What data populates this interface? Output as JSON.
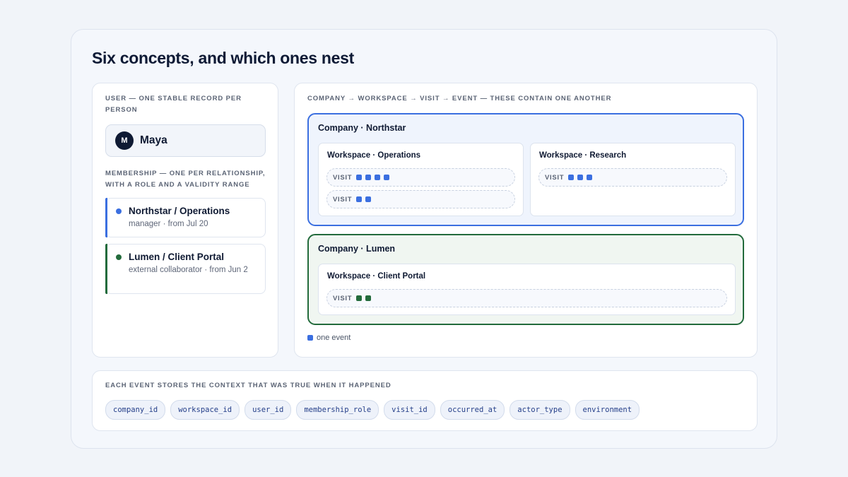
{
  "title": "Six concepts, and which ones nest",
  "user_panel": {
    "caption": "USER — ONE STABLE RECORD PER PERSON",
    "user": {
      "initial": "M",
      "name": "Maya"
    },
    "membership_caption": "MEMBERSHIP — ONE PER RELATIONSHIP, WITH A ROLE AND A VALIDITY RANGE",
    "memberships": [
      {
        "title": "Northstar / Operations",
        "subtitle": "manager · from Jul 20",
        "color": "#3b6fe0"
      },
      {
        "title": "Lumen / Client Portal",
        "subtitle": "external collaborator · from Jun 2",
        "color": "#236b3c"
      }
    ]
  },
  "nesting_panel": {
    "caption": "COMPANY → WORKSPACE → VISIT → EVENT — THESE CONTAIN ONE ANOTHER",
    "visit_label": "VISIT",
    "companies": [
      {
        "title": "Company · Northstar",
        "color": "#3b6fe0",
        "workspaces": [
          {
            "title": "Workspace · Operations",
            "visits": [
              4,
              2
            ]
          },
          {
            "title": "Workspace · Research",
            "visits": [
              3
            ]
          }
        ]
      },
      {
        "title": "Company · Lumen",
        "color": "#236b3c",
        "workspaces": [
          {
            "title": "Workspace · Client Portal",
            "visits": [
              2
            ]
          }
        ]
      }
    ],
    "legend": {
      "label": "one event",
      "color": "#3b6fe0"
    }
  },
  "context_panel": {
    "caption": "EACH EVENT STORES THE CONTEXT THAT WAS TRUE WHEN IT HAPPENED",
    "fields": [
      "company_id",
      "workspace_id",
      "user_id",
      "membership_role",
      "visit_id",
      "occurred_at",
      "actor_type",
      "environment"
    ]
  }
}
